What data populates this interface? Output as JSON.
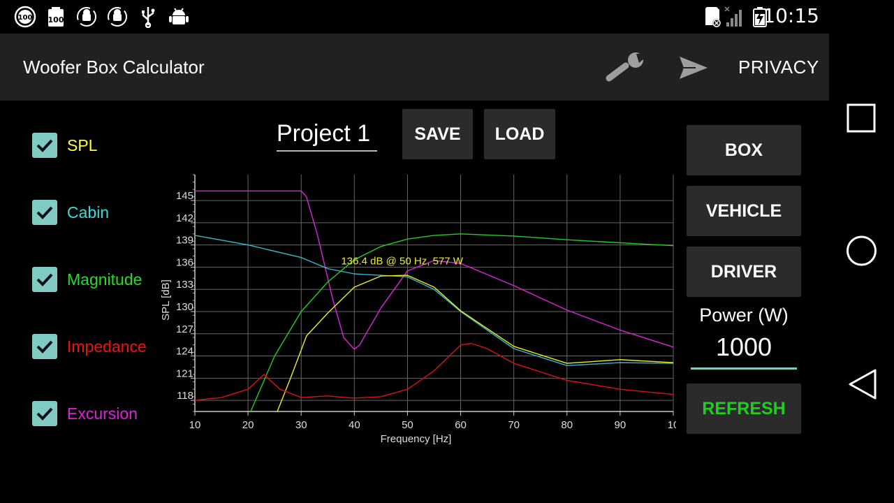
{
  "status_bar": {
    "time": "10:15",
    "icons": [
      "battery-100-circle-icon",
      "battery-100-icon",
      "android-sync-icon",
      "android-sync-icon",
      "usb-icon",
      "android-debug-icon",
      "sd-card-error-icon",
      "signal-icon",
      "battery-charging-icon"
    ]
  },
  "action_bar": {
    "title": "Woofer Box Calculator",
    "privacy_label": "PRIVACY"
  },
  "checkboxes": [
    {
      "label": "SPL",
      "color": "#ffff33",
      "checked": true
    },
    {
      "label": "Cabin",
      "color": "#33dddd",
      "checked": true
    },
    {
      "label": "Magnitude",
      "color": "#22dd22",
      "checked": true
    },
    {
      "label": "Impedance",
      "color": "#ee1111",
      "checked": true
    },
    {
      "label": "Excursion",
      "color": "#dd22dd",
      "checked": true
    }
  ],
  "project": {
    "name": "Project 1",
    "save_label": "SAVE",
    "load_label": "LOAD"
  },
  "side_buttons": {
    "box": "BOX",
    "vehicle": "VEHICLE",
    "driver": "DRIVER",
    "refresh": "REFRESH",
    "refresh_color": "#22cc22"
  },
  "power": {
    "label": "Power (W)",
    "value": "1000"
  },
  "chart_data": {
    "type": "line",
    "xlabel": "Frequency [Hz]",
    "ylabel": "SPL [dB]",
    "xlim": [
      10,
      100
    ],
    "ylim": [
      117,
      149
    ],
    "x_ticks": [
      "10",
      "20",
      "30",
      "40",
      "50",
      "60",
      "70",
      "80",
      "90",
      "10"
    ],
    "y_ticks": [
      "145",
      "142",
      "139",
      "136",
      "133",
      "130",
      "127",
      "124",
      "121",
      "118"
    ],
    "y_tick_values": [
      145.5,
      142.5,
      139.5,
      136.5,
      133.5,
      130.5,
      127.5,
      124.5,
      121.5,
      118.5
    ],
    "grid": true,
    "annotation": "136.4 dB @ 50 Hz, 577 W",
    "series": [
      {
        "name": "Excursion",
        "color": "#dd22dd",
        "x": [
          10,
          30,
          31,
          33,
          36,
          38,
          40,
          41,
          45,
          50,
          55,
          60,
          70,
          80,
          90,
          100
        ],
        "y": [
          146.8,
          146.8,
          146,
          141,
          132,
          127,
          125.4,
          126,
          131,
          136,
          137.4,
          137,
          134,
          130.7,
          128,
          125.7
        ]
      },
      {
        "name": "Cabin",
        "color": "#33bbcc",
        "x": [
          10,
          20,
          30,
          35,
          40,
          45,
          50,
          55,
          60,
          70,
          80,
          90,
          100
        ],
        "y": [
          140.8,
          139.5,
          137.8,
          136.3,
          135.6,
          135.4,
          135.2,
          133.5,
          130.5,
          125.5,
          123.2,
          123.6,
          123.5
        ]
      },
      {
        "name": "Magnitude",
        "color": "#22cc22",
        "x": [
          20.5,
          25,
          30,
          35,
          40,
          45,
          50,
          55,
          60,
          70,
          80,
          90,
          100
        ],
        "y": [
          117,
          124.5,
          130.5,
          134.5,
          137.5,
          139.3,
          140.3,
          140.8,
          141,
          140.7,
          140.2,
          139.8,
          139.4
        ]
      },
      {
        "name": "SPL",
        "color": "#eeee22",
        "x": [
          25.5,
          28,
          31,
          35,
          40,
          45,
          50,
          55,
          60,
          70,
          80,
          90,
          100
        ],
        "y": [
          117,
          121.5,
          127.2,
          130.3,
          133.8,
          135.3,
          135.4,
          133.8,
          130.6,
          125.8,
          123.5,
          124,
          123.6
        ]
      },
      {
        "name": "Impedance",
        "color": "#dd1111",
        "x": [
          10,
          15,
          20,
          23,
          26,
          30,
          35,
          40,
          45,
          50,
          55,
          60,
          62,
          65,
          70,
          80,
          90,
          100
        ],
        "y": [
          118.5,
          118.9,
          120,
          122,
          120,
          118.9,
          119.1,
          118.8,
          119,
          120,
          122.5,
          126,
          126.2,
          125.5,
          123.5,
          121.2,
          120,
          119.3
        ]
      }
    ]
  }
}
